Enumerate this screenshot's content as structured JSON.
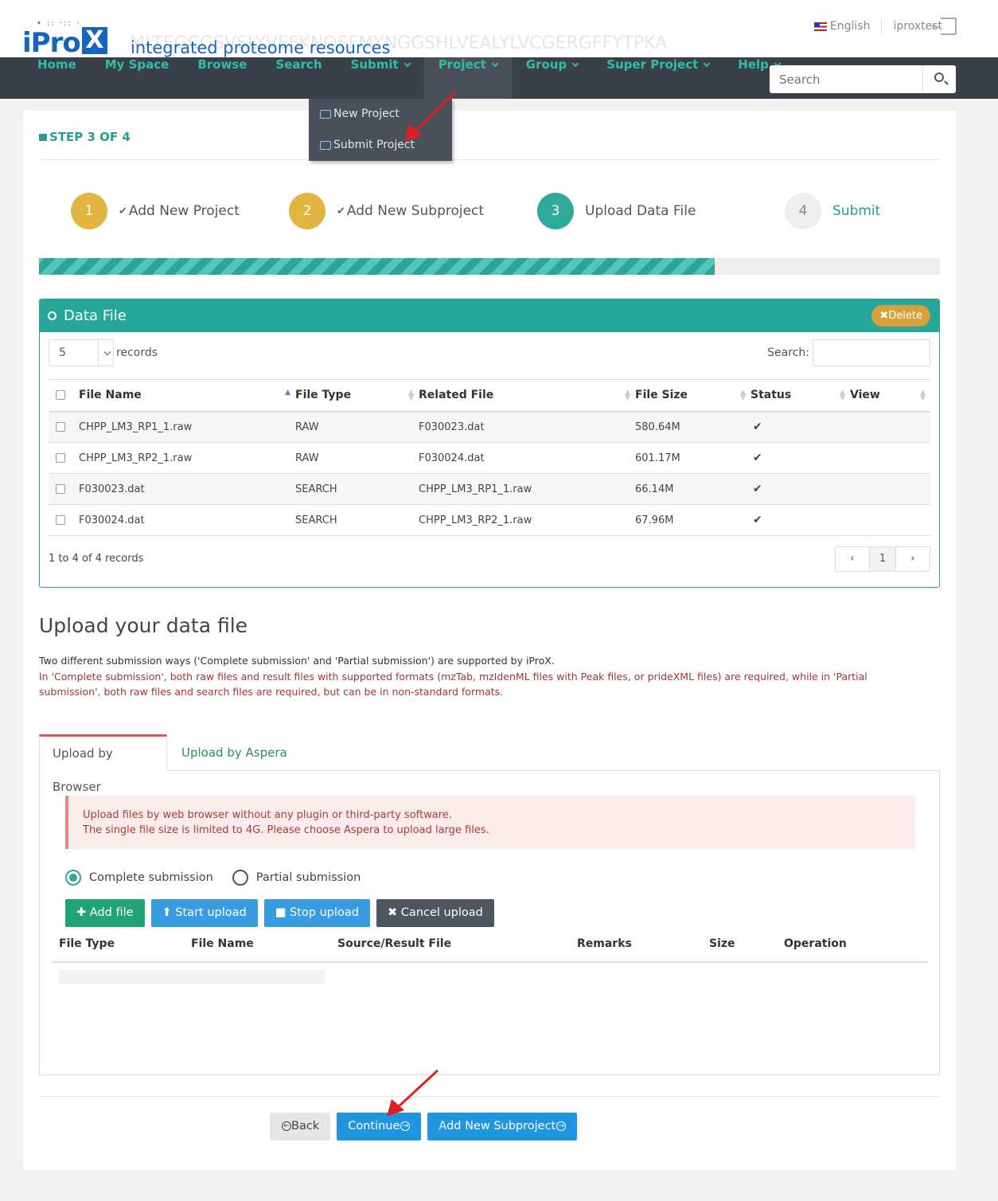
{
  "header": {
    "logo_text": "iPro",
    "logo_x": "X",
    "tagline": "integrated proteome resources",
    "watermark_sequence": "MLTEGCGSVSLYVEFKNQSFMYNGGSHLVEALYLVCGERGFFYTPKA",
    "language": "English",
    "username": "iproxtest"
  },
  "nav": {
    "items": [
      {
        "label": "Home"
      },
      {
        "label": "My Space"
      },
      {
        "label": "Browse"
      },
      {
        "label": "Search"
      },
      {
        "label": "Submit"
      },
      {
        "label": "Project"
      },
      {
        "label": "Group"
      },
      {
        "label": "Super Project"
      },
      {
        "label": "Help"
      }
    ],
    "search_placeholder": "Search"
  },
  "dropdown": {
    "items": [
      {
        "label": "New Project"
      },
      {
        "label": "Submit Project"
      }
    ]
  },
  "step_label": "STEP 3 OF 4",
  "steps": [
    {
      "num": "1",
      "label": "Add New Project",
      "state": "done"
    },
    {
      "num": "2",
      "label": "Add New Subproject",
      "state": "done"
    },
    {
      "num": "3",
      "label": "Upload Data File",
      "state": "current"
    },
    {
      "num": "4",
      "label": "Submit",
      "state": "todo"
    }
  ],
  "progress_percent": 75,
  "data_file": {
    "title": "Data File",
    "delete_label": "Delete",
    "length_value": "5",
    "length_suffix": "records",
    "search_label": "Search:",
    "columns": [
      "File Name",
      "File Type",
      "Related File",
      "File Size",
      "Status",
      "View"
    ],
    "rows": [
      {
        "name": "CHPP_LM3_RP1_1.raw",
        "type": "RAW",
        "related": "F030023.dat",
        "size": "580.64M",
        "status": "✔"
      },
      {
        "name": "CHPP_LM3_RP2_1.raw",
        "type": "RAW",
        "related": "F030024.dat",
        "size": "601.17M",
        "status": "✔"
      },
      {
        "name": "F030023.dat",
        "type": "SEARCH",
        "related": "CHPP_LM3_RP1_1.raw",
        "size": "66.14M",
        "status": "✔"
      },
      {
        "name": "F030024.dat",
        "type": "SEARCH",
        "related": "CHPP_LM3_RP2_1.raw",
        "size": "67.96M",
        "status": "✔"
      }
    ],
    "info": "1 to 4 of 4 records",
    "page": "1"
  },
  "upload": {
    "title": "Upload your data file",
    "desc1": "Two different submission ways ('Complete submission' and 'Partial submission') are supported by iProX.",
    "desc2": "In 'Complete submission', both raw files and result files with supported formats (mzTab, mzIdenML files with Peak files, or prideXML files) are required, while in 'Partial submission', both raw files and search files are required, but can be in non-standard formats.",
    "tab_browser": "Upload by Browser",
    "tab_aspera": "Upload by Aspera",
    "alert_line1": "Upload files by web browser without any plugin or third-party software.",
    "alert_line2": "The single file size is limited to 4G. Please choose Aspera to upload large files.",
    "radio_complete": "Complete submission",
    "radio_partial": "Partial submission",
    "btn_add": "Add file",
    "btn_start": "Start upload",
    "btn_stop": "Stop upload",
    "btn_cancel": "Cancel upload",
    "columns": [
      "File Type",
      "File Name",
      "Source/Result File",
      "Remarks",
      "Size",
      "Operation"
    ]
  },
  "footer_buttons": {
    "back": "Back",
    "continue": "Continue",
    "add_subproject": "Add New Subproject"
  },
  "colors": {
    "accent": "#27a79a",
    "nav_bg": "#3a4049",
    "step_done": "#e2b440",
    "primary_button": "#2196e0",
    "annotation_arrow": "#e02020"
  }
}
